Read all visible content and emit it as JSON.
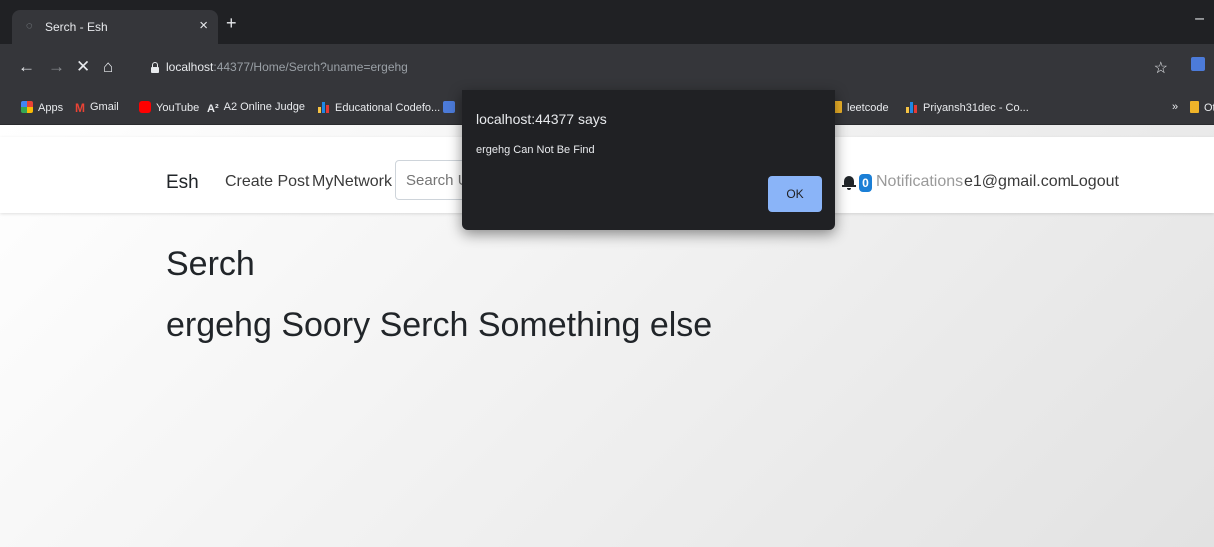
{
  "browser": {
    "tab": {
      "title": "Serch - Esh",
      "close_glyph": "×"
    },
    "new_tab_glyph": "+",
    "window_minimize_glyph": "–",
    "nav": {
      "back": "←",
      "forward": "→",
      "reload": "✕",
      "home": "⌂"
    },
    "address": {
      "host": "localhost",
      "rest": ":44377/Home/Serch?uname=ergehg"
    },
    "bookmark_star": "☆",
    "bookmarks": [
      {
        "label": "Apps",
        "icon": "apps-grid-icon"
      },
      {
        "label": "Gmail",
        "icon": "gmail-icon"
      },
      {
        "label": "YouTube",
        "icon": "youtube-icon"
      },
      {
        "label": "A2 Online Judge",
        "icon": "a2-icon"
      },
      {
        "label": "Educational Codefo...",
        "icon": "codeforces-icon"
      },
      {
        "label": "leetcode",
        "icon": "folder-icon"
      },
      {
        "label": "Priyansh31dec - Co...",
        "icon": "codeforces-icon"
      }
    ],
    "bookmarks_overflow": "»",
    "other_bookmarks": "Oth"
  },
  "navbar": {
    "brand": "Esh",
    "links": [
      "Create Post",
      "MyNetwork"
    ],
    "search_placeholder": "Search Users",
    "notifications_count": "0",
    "notifications_label": "Notifications",
    "user_email": "e1@gmail.com",
    "logout": "Logout"
  },
  "main": {
    "heading": "Serch",
    "message": "ergehg Soory Serch Something else"
  },
  "dialog": {
    "title": "localhost:44377 says",
    "message": "ergehg Can Not Be Find",
    "ok_label": "OK"
  },
  "colors": {
    "chrome_dark": "#202124",
    "chrome_toolbar": "#35363a",
    "dialog_button": "#8ab4f8",
    "badge": "#1b7fd6"
  }
}
